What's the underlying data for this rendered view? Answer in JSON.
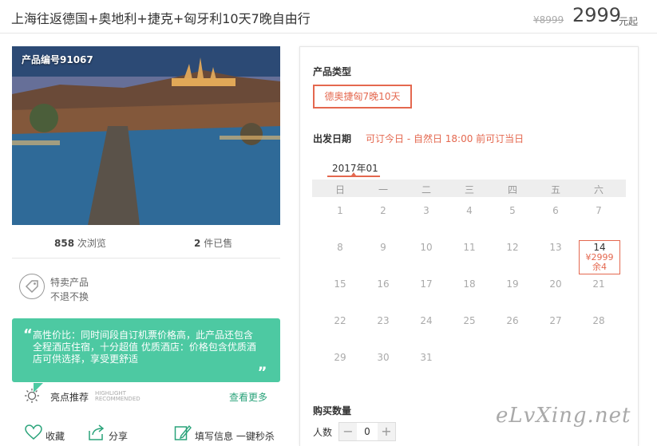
{
  "header": {
    "title": "上海往返德国+奥地利+捷克+匈牙利10天7晚自由行",
    "price_old": "¥8999",
    "price_now": "2999",
    "price_suffix": "元起"
  },
  "photo": {
    "product_code": "产品编号91067"
  },
  "stats": {
    "views_count": "858",
    "views_label": "次浏览",
    "sold_count": "2",
    "sold_label": "件已售"
  },
  "special": {
    "title": "特卖产品",
    "subtitle": "不退不换"
  },
  "highlights": {
    "quote_open": "“",
    "quote_close": "„",
    "text": "高性价比：同时间段自订机票价格高，此产品还包含全程酒店住宿，十分超值 优质酒店：价格包含优质酒店可供选择，享受更舒适",
    "label": "亮点推荐",
    "label_en": "HIGHLIGHT RECOMMENDED",
    "more": "查看更多"
  },
  "actions": {
    "favorite": "收藏",
    "share": "分享",
    "fill_info": "填写信息 一键秒杀"
  },
  "booking": {
    "type_label": "产品类型",
    "type_option": "德奥捷匈7晚10天",
    "date_label": "出发日期",
    "date_note": "可订今日 - 自然日 18:00 前可订当日",
    "month": "2017年01",
    "weekdays": [
      "日",
      "一",
      "二",
      "三",
      "四",
      "五",
      "六"
    ],
    "days": [
      [
        "1",
        "2",
        "3",
        "4",
        "5",
        "6",
        "7"
      ],
      [
        "8",
        "9",
        "10",
        "11",
        "12",
        "13",
        ""
      ],
      [
        "15",
        "16",
        "17",
        "18",
        "19",
        "20",
        "21"
      ],
      [
        "22",
        "23",
        "24",
        "25",
        "26",
        "27",
        "28"
      ],
      [
        "29",
        "30",
        "31",
        "",
        "",
        "",
        ""
      ]
    ],
    "selected_day": {
      "day": "14",
      "price": "¥2999",
      "remaining": "余4"
    },
    "qty_title": "购买数量",
    "qty_label": "人数",
    "qty_value": "0",
    "minus": "−",
    "plus": "+"
  },
  "watermark": "eLvXing.net",
  "colors": {
    "accent": "#e4684f",
    "green": "#4dc9a2",
    "link": "#2aa37a"
  }
}
